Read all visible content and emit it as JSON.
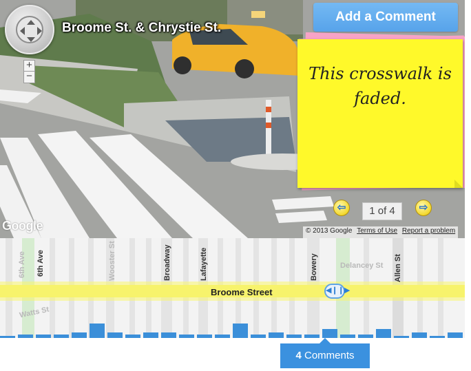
{
  "location": {
    "title": "Broome St. & Chrystie St."
  },
  "actions": {
    "add_comment": "Add a Comment"
  },
  "note": {
    "text": "This crosswalk is faded."
  },
  "pager": {
    "current": 1,
    "total": 4,
    "label": "1 of 4"
  },
  "attribution": {
    "google_logo": "Google",
    "copyright": "© 2013 Google",
    "terms": "Terms of Use",
    "report": "Report a problem"
  },
  "zoom": {
    "in": "+",
    "out": "−"
  },
  "map": {
    "main_street": "Broome Street",
    "cross_streets": [
      {
        "name": "6th Ave",
        "faded": true
      },
      {
        "name": "6th Ave",
        "faded": false
      },
      {
        "name": "Wooster St",
        "faded": true
      },
      {
        "name": "Broadway",
        "faded": false
      },
      {
        "name": "Lafayette",
        "faded": false
      },
      {
        "name": "Bowery",
        "faded": false
      },
      {
        "name": "Allen St",
        "faded": false
      }
    ],
    "other_streets": [
      {
        "name": "Delancey St"
      },
      {
        "name": "Watts St"
      }
    ],
    "scrubber_icon": "drag-handle-icon"
  },
  "histogram": {
    "values": [
      1,
      2,
      2,
      2,
      3,
      8,
      3,
      2,
      3,
      3,
      2,
      2,
      2,
      8,
      2,
      3,
      2,
      2,
      5,
      2,
      2,
      5,
      1,
      3,
      1,
      3
    ]
  },
  "comments": {
    "count": "4",
    "label": "Comments"
  },
  "colors": {
    "accent": "#3b91df",
    "note_yellow": "#fff92a",
    "note_pink": "#f7a3c6",
    "highlight": "#f7f36c"
  }
}
